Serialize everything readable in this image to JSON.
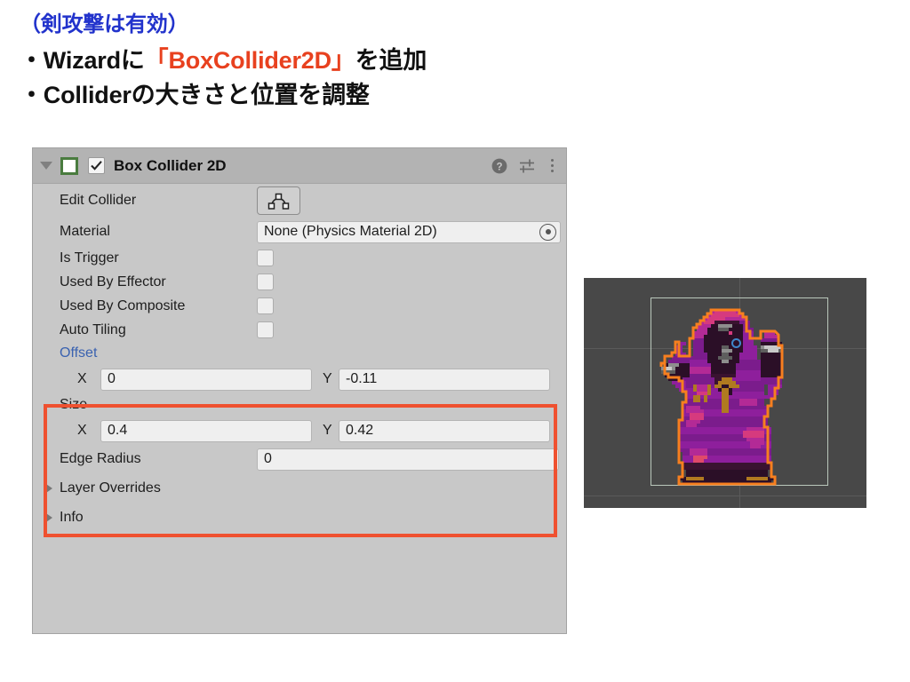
{
  "slide": {
    "heading_note": "（剣攻撃は有効）",
    "bullet_1_pre": "・Wizardに",
    "bullet_1_accent": "「BoxCollider2D」",
    "bullet_1_post": "を追加",
    "bullet_2": "・Colliderの大きさと位置を調整",
    "accent_color": "#e8411f",
    "note_color": "#2233cc"
  },
  "inspector": {
    "header": {
      "title": "Box Collider 2D",
      "foldout_icon": "triangle-down-icon",
      "component_icon": "box-collider-2d-icon",
      "enabled_checkbox": true,
      "help_icon": "help-icon",
      "preset_icon": "preset-settings-icon",
      "menu_icon": "more-options-icon"
    },
    "rows": {
      "edit_collider_label": "Edit Collider",
      "edit_collider_icon": "edit-collider-icon",
      "material_label": "Material",
      "material_value": "None (Physics Material 2D)",
      "material_picker_icon": "object-picker-icon",
      "is_trigger_label": "Is Trigger",
      "is_trigger_value": false,
      "used_by_effector_label": "Used By Effector",
      "used_by_effector_value": false,
      "used_by_composite_label": "Used By Composite",
      "used_by_composite_value": false,
      "auto_tiling_label": "Auto Tiling",
      "auto_tiling_value": false,
      "offset_label": "Offset",
      "offset_x_axis": "X",
      "offset_x_value": "0",
      "offset_y_axis": "Y",
      "offset_y_value": "-0.11",
      "size_label": "Size",
      "size_x_axis": "X",
      "size_x_value": "0.4",
      "size_y_axis": "Y",
      "size_y_value": "0.42",
      "edge_radius_label": "Edge Radius",
      "edge_radius_value": "0",
      "layer_overrides_label": "Layer Overrides",
      "info_label": "Info"
    },
    "highlight_color": "#ef5130"
  },
  "scene_preview": {
    "sprite_name": "wizard-sprite",
    "collider_outline_color": "#f77f1f",
    "bounds_color": "#b9c7bb",
    "pivot_color": "#3f87c9",
    "background_color": "#484848"
  }
}
